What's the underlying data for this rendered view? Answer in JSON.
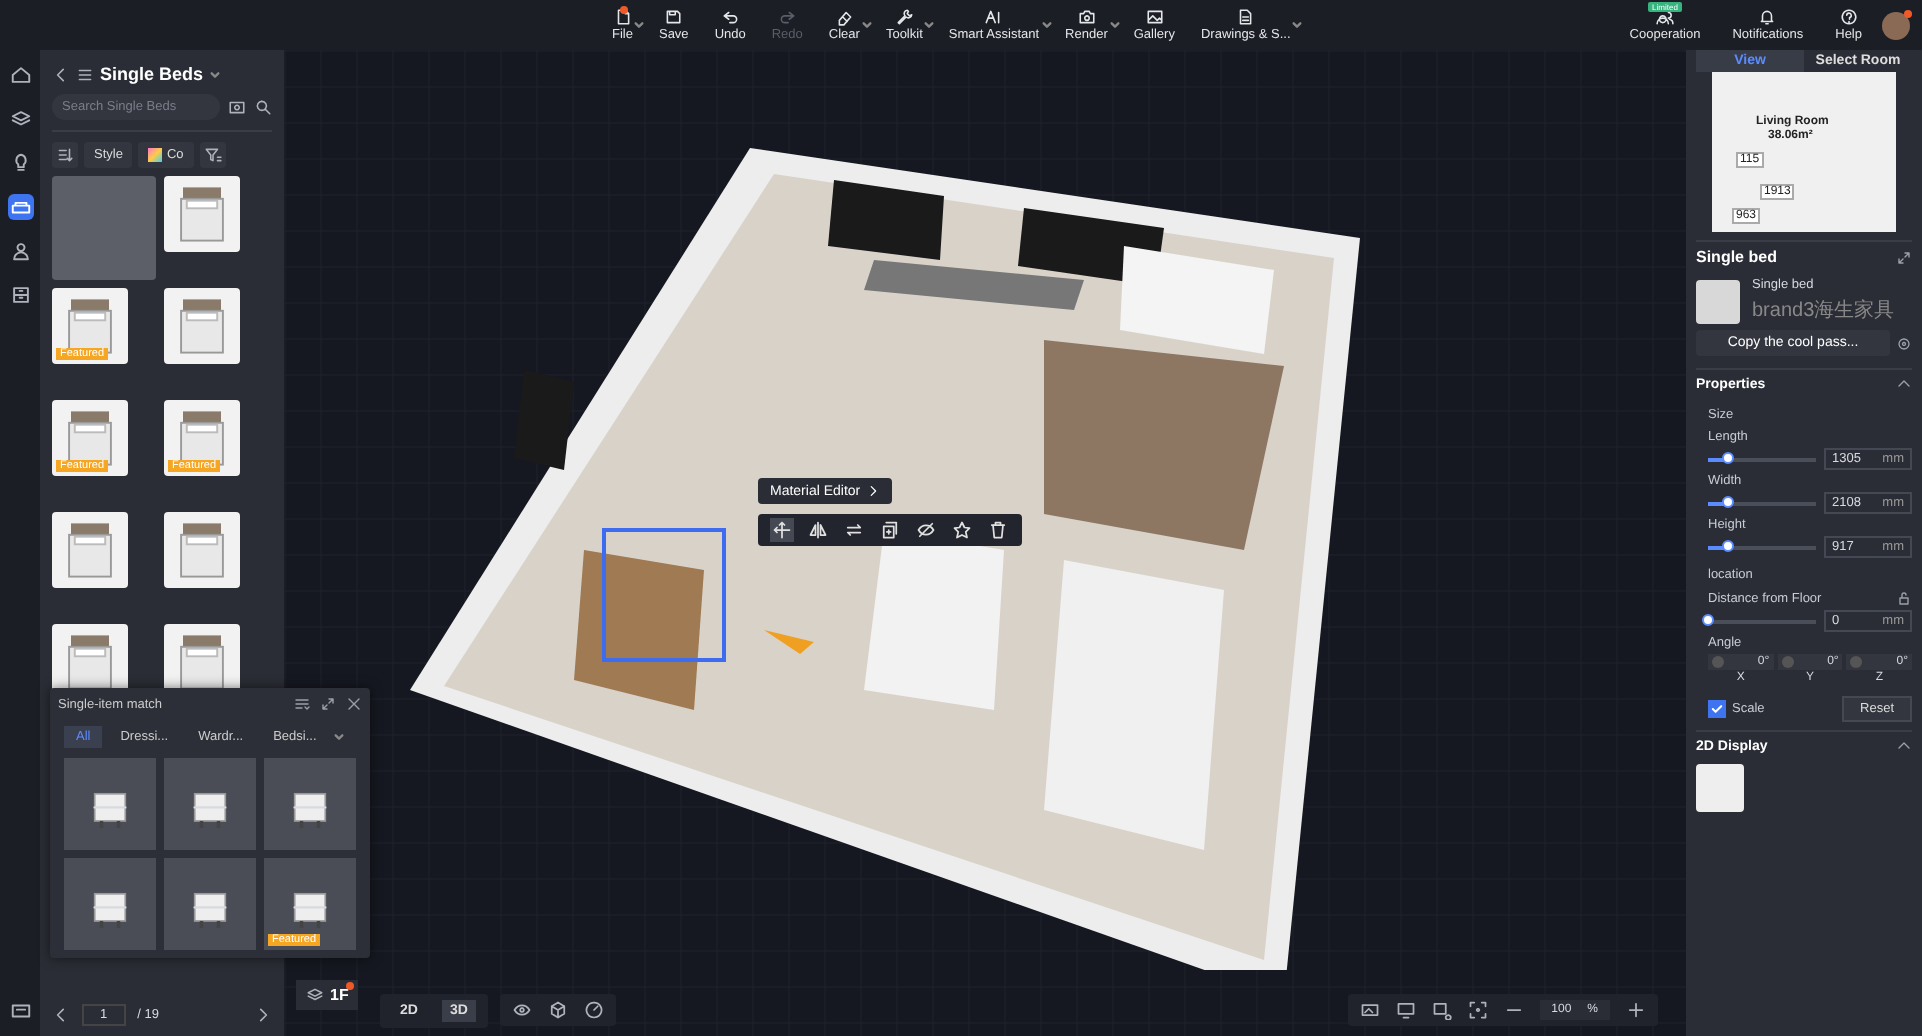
{
  "toolbar": {
    "items": [
      {
        "label": "File",
        "disabled": false,
        "dot": true,
        "menu": true
      },
      {
        "label": "Save",
        "disabled": false,
        "dot": false,
        "menu": false
      },
      {
        "label": "Undo",
        "disabled": false,
        "dot": false,
        "menu": false
      },
      {
        "label": "Redo",
        "disabled": true,
        "dot": false,
        "menu": false
      },
      {
        "label": "Clear",
        "disabled": false,
        "dot": false,
        "menu": true
      },
      {
        "label": "Toolkit",
        "disabled": false,
        "dot": false,
        "menu": true
      },
      {
        "label": "Smart Assistant",
        "disabled": false,
        "dot": false,
        "menu": true
      },
      {
        "label": "Render",
        "disabled": false,
        "dot": false,
        "menu": true
      },
      {
        "label": "Gallery",
        "disabled": false,
        "dot": false,
        "menu": false
      },
      {
        "label": "Drawings & S...",
        "disabled": false,
        "dot": false,
        "menu": true
      }
    ],
    "right": [
      {
        "label": "Cooperation",
        "badge": "Limited"
      },
      {
        "label": "Notifications"
      },
      {
        "label": "Help"
      }
    ],
    "avatar_dot": true
  },
  "rail": [
    {
      "selected": false
    },
    {
      "selected": false
    },
    {
      "selected": false
    },
    {
      "selected": true
    },
    {
      "selected": false
    },
    {
      "selected": false
    },
    {
      "selected": false
    }
  ],
  "catalog": {
    "title": "Single Beds",
    "search": {
      "placeholder": "Search Single Beds"
    },
    "filters": [
      "Style",
      "Co"
    ],
    "products": [
      {
        "kind": "empty"
      },
      {
        "kind": "bed"
      },
      {
        "kind": "bed",
        "badge": "Featured"
      },
      {
        "kind": "bed"
      },
      {
        "kind": "bed",
        "badge": "Featured"
      },
      {
        "kind": "bed",
        "badge": "Featured"
      },
      {
        "kind": "bed"
      },
      {
        "kind": "bed"
      },
      {
        "kind": "bed"
      },
      {
        "kind": "bed"
      }
    ],
    "page": "1",
    "pages": "/ 19"
  },
  "match_panel": {
    "title": "Single-item match",
    "tabs": [
      {
        "label": "All",
        "selected": true
      },
      {
        "label": "Dressi...",
        "selected": false
      },
      {
        "label": "Wardr...",
        "selected": false
      },
      {
        "label": "Bedsi...",
        "selected": false
      }
    ],
    "badge_label": "Featured",
    "items": [
      {
        "featured": false
      },
      {
        "featured": false
      },
      {
        "featured": false
      },
      {
        "featured": false
      },
      {
        "featured": false
      },
      {
        "featured": true
      }
    ]
  },
  "canvas": {
    "popup": {
      "label": "Material Editor"
    },
    "tools": [
      {
        "selected": true
      },
      {
        "selected": false
      },
      {
        "selected": false
      },
      {
        "selected": false
      },
      {
        "selected": false
      },
      {
        "selected": false
      },
      {
        "selected": false
      }
    ],
    "floor": {
      "label": "1F",
      "dot": true
    },
    "views": [
      {
        "label": "2D",
        "selected": false
      },
      {
        "label": "3D",
        "selected": true
      }
    ],
    "zoom": {
      "value": "100",
      "unit": "%"
    }
  },
  "minimap": {
    "tabs": [
      {
        "label": "View",
        "selected": true
      },
      {
        "label": "Select Room",
        "selected": false
      }
    ],
    "room": "Living Room",
    "area": "38.06m²",
    "dims": [
      "115",
      "1913",
      "963"
    ]
  },
  "inspector": {
    "title": "Single bed",
    "product": {
      "name": "Single bed",
      "brand": "brand3海生家具"
    },
    "copy_button": "Copy the cool pass...",
    "properties": {
      "title": "Properties",
      "size_title": "Size",
      "size": [
        {
          "label": "Length",
          "value": "1305",
          "unit": "mm",
          "level": 0.18
        },
        {
          "label": "Width",
          "value": "2108",
          "unit": "mm",
          "level": 0.18
        },
        {
          "label": "Height",
          "value": "917",
          "unit": "mm",
          "level": 0.18
        }
      ],
      "location_title": "location",
      "distance": {
        "label": "Distance from Floor",
        "value": "0",
        "unit": "mm",
        "level": 0
      },
      "angle_title": "Angle",
      "angles": [
        {
          "value": "0°",
          "axis": "X"
        },
        {
          "value": "0°",
          "axis": "Y"
        },
        {
          "value": "0°",
          "axis": "Z"
        }
      ],
      "scale": {
        "label": "Scale",
        "checked": true
      },
      "reset": "Reset"
    },
    "display_title": "2D Display"
  }
}
